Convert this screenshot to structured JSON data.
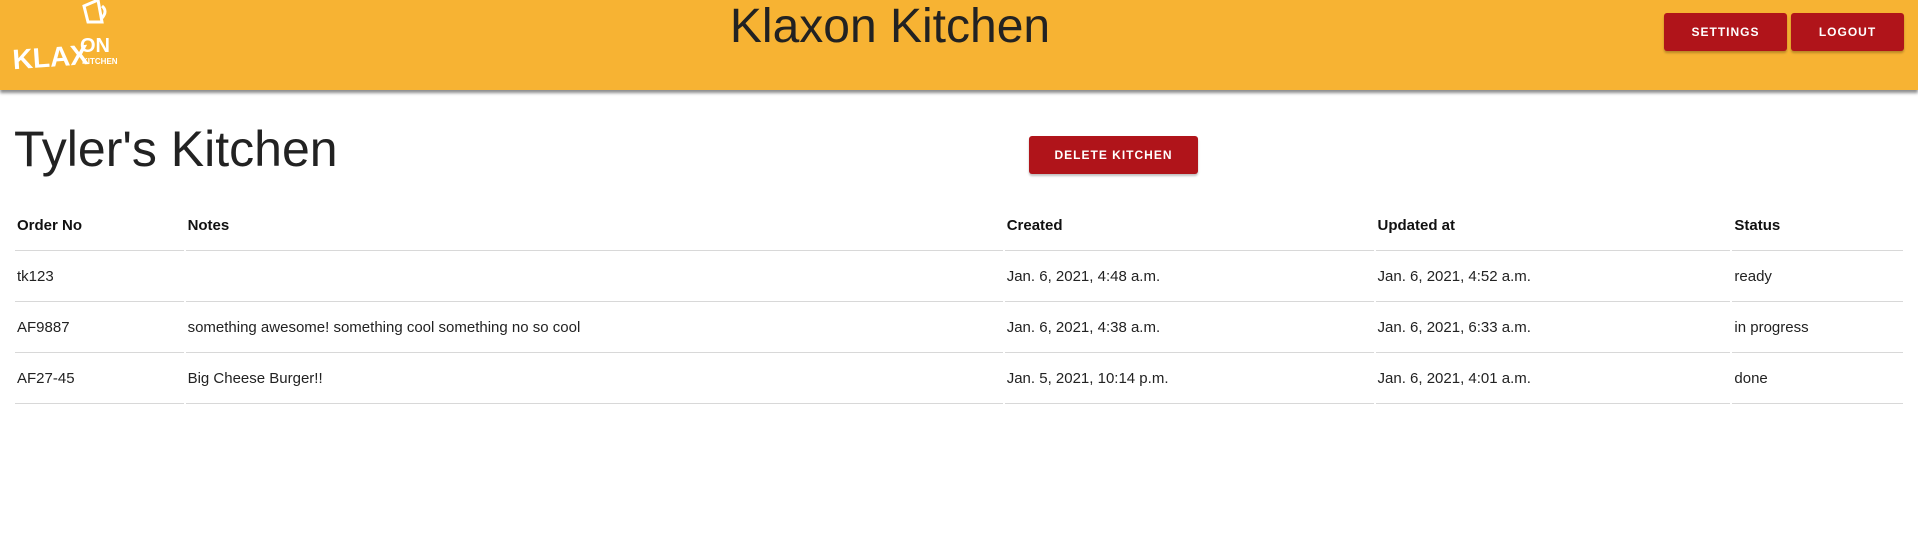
{
  "header": {
    "app_title": "Klaxon Kitchen",
    "logo_text": "KLAXON KITCHEN",
    "settings_label": "SETTINGS",
    "logout_label": "LOGOUT"
  },
  "page": {
    "kitchen_title": "Tyler's Kitchen",
    "delete_label": "DELETE KITCHEN"
  },
  "table": {
    "columns": [
      "Order No",
      "Notes",
      "Created",
      "Updated at",
      "Status"
    ],
    "rows": [
      {
        "order_no": "tk123",
        "notes": "",
        "created": "Jan. 6, 2021, 4:48 a.m.",
        "updated": "Jan. 6, 2021, 4:52 a.m.",
        "status": "ready"
      },
      {
        "order_no": "AF9887",
        "notes": "something awesome! something cool something no so cool",
        "created": "Jan. 6, 2021, 4:38 a.m.",
        "updated": "Jan. 6, 2021, 6:33 a.m.",
        "status": "in progress"
      },
      {
        "order_no": "AF27-45",
        "notes": "Big Cheese Burger!!",
        "created": "Jan. 5, 2021, 10:14 p.m.",
        "updated": "Jan. 6, 2021, 4:01 a.m.",
        "status": "done"
      }
    ]
  },
  "colors": {
    "header_bg": "#f7b333",
    "button_bg": "#b0141a"
  }
}
